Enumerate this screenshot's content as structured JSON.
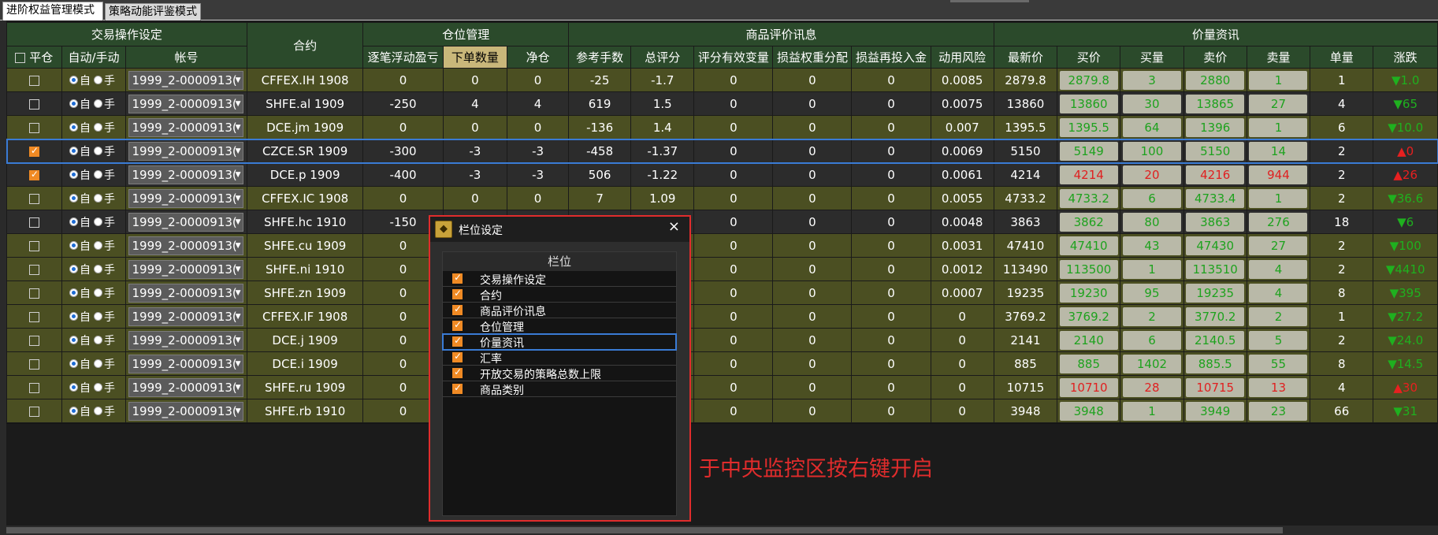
{
  "tabs": [
    "进阶权益管理模式",
    "策略动能评鉴模式"
  ],
  "groups": [
    "交易操作设定",
    "合约",
    "仓位管理",
    "商品评价讯息",
    "价量资讯"
  ],
  "columns": {
    "close_all": "平仓",
    "auto_manual": "自动/手动",
    "account": "帐号",
    "float_pl": "逐笔浮动盈亏",
    "order_qty": "下单数量",
    "net_pos": "净仓",
    "ref_lots": "参考手数",
    "total_score": "总评分",
    "effective_var": "评分有效变量",
    "pl_weight": "损益权重分配",
    "pl_reinvest": "损益再投入金",
    "risk_used": "动用风险",
    "last": "最新价",
    "bid": "买价",
    "bid_qty": "买量",
    "ask": "卖价",
    "ask_qty": "卖量",
    "volume": "单量",
    "change": "涨跌"
  },
  "radio_labels": {
    "auto": "自",
    "manual": "手"
  },
  "rows": [
    {
      "checked": false,
      "style": "olive",
      "account": "1999_2-0000913(",
      "contract": "CFFEX.IH 1908",
      "float_pl": "0",
      "order_qty": "0",
      "net_pos": "0",
      "ref_lots": "-25",
      "total_score": "-1.7",
      "effective_var": "0",
      "pl_weight": "0",
      "pl_reinvest": "0",
      "risk_used": "0.0085",
      "last": "2879.8",
      "bid": "2879.8",
      "bid_qty": "3",
      "ask": "2880",
      "ask_qty": "1",
      "volume": "1",
      "change": "▼1.0",
      "price_color": "green",
      "chg_dir": "down"
    },
    {
      "checked": false,
      "style": "dark",
      "account": "1999_2-0000913(",
      "contract": "SHFE.al 1909",
      "float_pl": "-250",
      "order_qty": "4",
      "net_pos": "4",
      "ref_lots": "619",
      "total_score": "1.5",
      "effective_var": "0",
      "pl_weight": "0",
      "pl_reinvest": "0",
      "risk_used": "0.0075",
      "last": "13860",
      "bid": "13860",
      "bid_qty": "30",
      "ask": "13865",
      "ask_qty": "27",
      "volume": "4",
      "change": "▼65",
      "price_color": "green",
      "chg_dir": "down"
    },
    {
      "checked": false,
      "style": "olive",
      "account": "1999_2-0000913(",
      "contract": "DCE.jm 1909",
      "float_pl": "0",
      "order_qty": "0",
      "net_pos": "0",
      "ref_lots": "-136",
      "total_score": "1.4",
      "effective_var": "0",
      "pl_weight": "0",
      "pl_reinvest": "0",
      "risk_used": "0.007",
      "last": "1395.5",
      "bid": "1395.5",
      "bid_qty": "64",
      "ask": "1396",
      "ask_qty": "1",
      "volume": "6",
      "change": "▼10.0",
      "price_color": "green",
      "chg_dir": "down"
    },
    {
      "checked": true,
      "style": "selected",
      "account": "1999_2-0000913(",
      "contract": "CZCE.SR 1909",
      "float_pl": "-300",
      "order_qty": "-3",
      "net_pos": "-3",
      "ref_lots": "-458",
      "total_score": "-1.37",
      "effective_var": "0",
      "pl_weight": "0",
      "pl_reinvest": "0",
      "risk_used": "0.0069",
      "last": "5150",
      "bid": "5149",
      "bid_qty": "100",
      "ask": "5150",
      "ask_qty": "14",
      "volume": "2",
      "change": "▲0",
      "price_color": "green",
      "chg_dir": "up"
    },
    {
      "checked": true,
      "style": "dark",
      "account": "1999_2-0000913(",
      "contract": "DCE.p 1909",
      "float_pl": "-400",
      "order_qty": "-3",
      "net_pos": "-3",
      "ref_lots": "506",
      "total_score": "-1.22",
      "effective_var": "0",
      "pl_weight": "0",
      "pl_reinvest": "0",
      "risk_used": "0.0061",
      "last": "4214",
      "bid": "4214",
      "bid_qty": "20",
      "ask": "4216",
      "ask_qty": "944",
      "volume": "2",
      "change": "▲26",
      "price_color": "red",
      "chg_dir": "up"
    },
    {
      "checked": false,
      "style": "olive",
      "account": "1999_2-0000913(",
      "contract": "CFFEX.IC 1908",
      "float_pl": "0",
      "order_qty": "0",
      "net_pos": "0",
      "ref_lots": "7",
      "total_score": "1.09",
      "effective_var": "0",
      "pl_weight": "0",
      "pl_reinvest": "0",
      "risk_used": "0.0055",
      "last": "4733.2",
      "bid": "4733.2",
      "bid_qty": "6",
      "ask": "4733.4",
      "ask_qty": "1",
      "volume": "2",
      "change": "▼36.6",
      "price_color": "green",
      "chg_dir": "down"
    },
    {
      "checked": false,
      "style": "dark",
      "account": "1999_2-0000913(",
      "contract": "SHFE.hc 1910",
      "float_pl": "-150",
      "order_qty": "",
      "net_pos": "",
      "ref_lots": "",
      "total_score": "",
      "effective_var": "0",
      "pl_weight": "0",
      "pl_reinvest": "0",
      "risk_used": "0.0048",
      "last": "3863",
      "bid": "3862",
      "bid_qty": "80",
      "ask": "3863",
      "ask_qty": "276",
      "volume": "18",
      "change": "▼6",
      "price_color": "green",
      "chg_dir": "down"
    },
    {
      "checked": false,
      "style": "olive",
      "account": "1999_2-0000913(",
      "contract": "SHFE.cu 1909",
      "float_pl": "0",
      "order_qty": "",
      "net_pos": "",
      "ref_lots": "",
      "total_score": "",
      "effective_var": "0",
      "pl_weight": "0",
      "pl_reinvest": "0",
      "risk_used": "0.0031",
      "last": "47410",
      "bid": "47410",
      "bid_qty": "43",
      "ask": "47430",
      "ask_qty": "27",
      "volume": "2",
      "change": "▼100",
      "price_color": "green",
      "chg_dir": "down"
    },
    {
      "checked": false,
      "style": "olive",
      "account": "1999_2-0000913(",
      "contract": "SHFE.ni 1910",
      "float_pl": "0",
      "order_qty": "",
      "net_pos": "",
      "ref_lots": "",
      "total_score": "",
      "effective_var": "0",
      "pl_weight": "0",
      "pl_reinvest": "0",
      "risk_used": "0.0012",
      "last": "113490",
      "bid": "113500",
      "bid_qty": "1",
      "ask": "113510",
      "ask_qty": "4",
      "volume": "2",
      "change": "▼4410",
      "price_color": "green",
      "chg_dir": "down"
    },
    {
      "checked": false,
      "style": "olive",
      "account": "1999_2-0000913(",
      "contract": "SHFE.zn 1909",
      "float_pl": "0",
      "order_qty": "",
      "net_pos": "",
      "ref_lots": "",
      "total_score": "",
      "effective_var": "0",
      "pl_weight": "0",
      "pl_reinvest": "0",
      "risk_used": "0.0007",
      "last": "19235",
      "bid": "19230",
      "bid_qty": "95",
      "ask": "19235",
      "ask_qty": "4",
      "volume": "8",
      "change": "▼395",
      "price_color": "green",
      "chg_dir": "down"
    },
    {
      "checked": false,
      "style": "olive",
      "account": "1999_2-0000913(",
      "contract": "CFFEX.IF 1908",
      "float_pl": "0",
      "order_qty": "",
      "net_pos": "",
      "ref_lots": "",
      "total_score": "",
      "effective_var": "0",
      "pl_weight": "0",
      "pl_reinvest": "0",
      "risk_used": "0",
      "last": "3769.2",
      "bid": "3769.2",
      "bid_qty": "2",
      "ask": "3770.2",
      "ask_qty": "2",
      "volume": "1",
      "change": "▼27.2",
      "price_color": "green",
      "chg_dir": "down"
    },
    {
      "checked": false,
      "style": "olive",
      "account": "1999_2-0000913(",
      "contract": "DCE.j 1909",
      "float_pl": "0",
      "order_qty": "",
      "net_pos": "",
      "ref_lots": "",
      "total_score": "",
      "effective_var": "0",
      "pl_weight": "0",
      "pl_reinvest": "0",
      "risk_used": "0",
      "last": "2141",
      "bid": "2140",
      "bid_qty": "6",
      "ask": "2140.5",
      "ask_qty": "5",
      "volume": "2",
      "change": "▼24.0",
      "price_color": "green",
      "chg_dir": "down"
    },
    {
      "checked": false,
      "style": "olive",
      "account": "1999_2-0000913(",
      "contract": "DCE.i 1909",
      "float_pl": "0",
      "order_qty": "",
      "net_pos": "",
      "ref_lots": "",
      "total_score": "",
      "effective_var": "0",
      "pl_weight": "0",
      "pl_reinvest": "0",
      "risk_used": "0",
      "last": "885",
      "bid": "885",
      "bid_qty": "1402",
      "ask": "885.5",
      "ask_qty": "55",
      "volume": "8",
      "change": "▼14.5",
      "price_color": "green",
      "chg_dir": "down"
    },
    {
      "checked": false,
      "style": "olive",
      "account": "1999_2-0000913(",
      "contract": "SHFE.ru 1909",
      "float_pl": "0",
      "order_qty": "",
      "net_pos": "",
      "ref_lots": "",
      "total_score": "",
      "effective_var": "0",
      "pl_weight": "0",
      "pl_reinvest": "0",
      "risk_used": "0",
      "last": "10715",
      "bid": "10710",
      "bid_qty": "28",
      "ask": "10715",
      "ask_qty": "13",
      "volume": "4",
      "change": "▲30",
      "price_color": "red",
      "chg_dir": "up"
    },
    {
      "checked": false,
      "style": "olive",
      "account": "1999_2-0000913(",
      "contract": "SHFE.rb 1910",
      "float_pl": "0",
      "order_qty": "",
      "net_pos": "",
      "ref_lots": "",
      "total_score": "",
      "effective_var": "0",
      "pl_weight": "0",
      "pl_reinvest": "0",
      "risk_used": "0",
      "last": "3948",
      "bid": "3948",
      "bid_qty": "1",
      "ask": "3949",
      "ask_qty": "23",
      "volume": "66",
      "change": "▼31",
      "price_color": "green",
      "chg_dir": "down"
    }
  ],
  "dialog": {
    "title": "栏位设定",
    "close": "×",
    "column_header": "栏位",
    "items": [
      {
        "label": "交易操作设定",
        "checked": true
      },
      {
        "label": "合约",
        "checked": true
      },
      {
        "label": "商品评价讯息",
        "checked": true
      },
      {
        "label": "仓位管理",
        "checked": true
      },
      {
        "label": "价量资讯",
        "checked": true
      },
      {
        "label": "汇率",
        "checked": true
      },
      {
        "label": "开放交易的策略总数上限",
        "checked": true
      },
      {
        "label": "商品类别",
        "checked": true
      }
    ],
    "focused_index": 4
  },
  "hint": "于中央监控区按右键开启",
  "colors": {
    "accent_blue": "#3a7bd5",
    "annotation_red": "#e02c2c",
    "up_red": "#e82020",
    "down_green": "#1fb01f",
    "header_green": "#2b4a2b",
    "row_olive": "#4b4f22"
  }
}
